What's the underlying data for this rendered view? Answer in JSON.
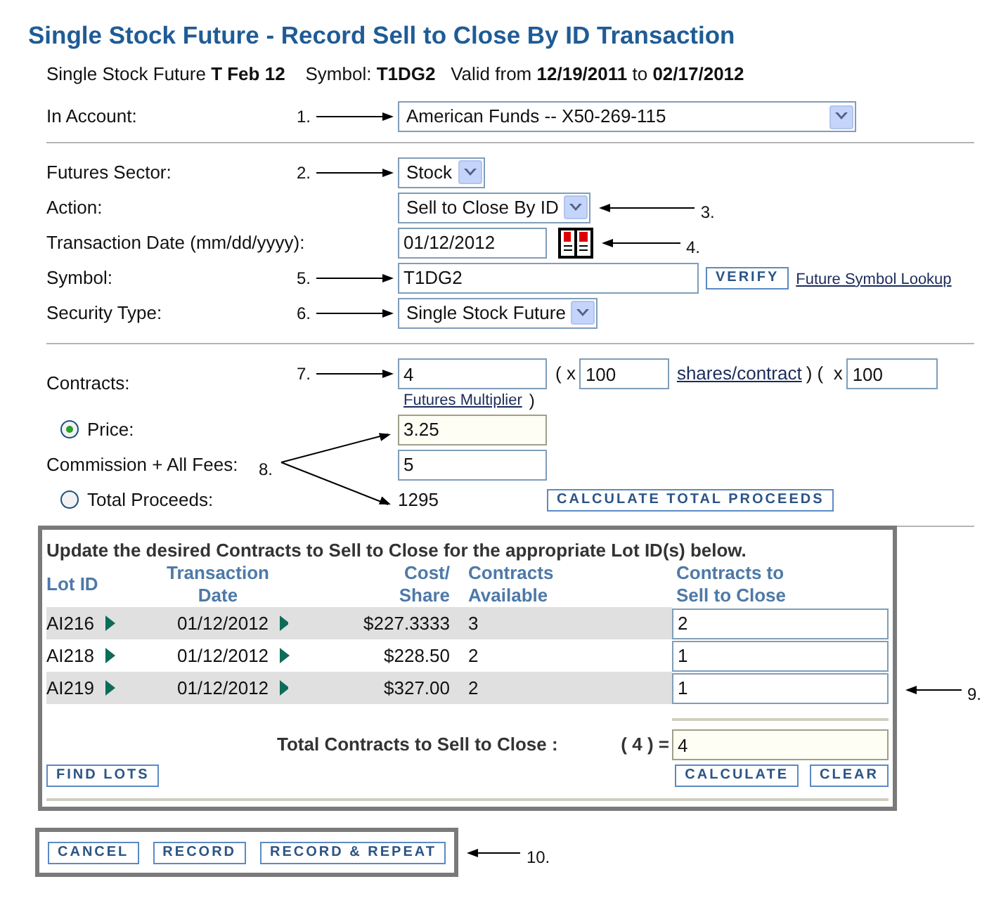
{
  "title": "Single Stock Future - Record Sell to Close By ID Transaction",
  "summary": "Single Stock Future **T Feb 12**    Symbol: **T1DG2**   Valid from **12/19/2011** to **02/17/2012**",
  "account": {
    "label": "In Account:",
    "value": "American Funds -- X50-269-115",
    "callout": "1."
  },
  "fields": [
    {
      "kind": "select",
      "label": "Futures Sector:",
      "value": "Stock",
      "callout": "2.",
      "callout_after": false
    },
    {
      "kind": "select",
      "label": "Action:",
      "value": "Sell to Close By ID",
      "callout": "3.",
      "callout_after": true
    },
    {
      "kind": "date",
      "label": "Transaction Date (mm/dd/yyyy):",
      "value": "01/12/2012",
      "callout": "4.",
      "callout_after": true
    },
    {
      "kind": "symbol",
      "label": "Symbol:",
      "value": "T1DG2",
      "callout": "5.",
      "callout_after": false,
      "button": "VERIFY",
      "link": "Future Symbol Lookup"
    },
    {
      "kind": "select",
      "label": "Security Type:",
      "value": "Single Stock Future",
      "callout": "6.",
      "callout_after": false
    }
  ],
  "contracts": {
    "label": "Contracts:",
    "callout": "7.",
    "value": "4",
    "times_1": "( x",
    "shares": "100",
    "shares_link": "shares/contract",
    "times_2": ") (  x",
    "multiplier": "100",
    "multiplier_link": "Futures Multiplier",
    "close": ")"
  },
  "pricing": {
    "callout": "8.",
    "button": "CALCULATE TOTAL PROCEEDS",
    "rows": [
      {
        "kind": "radio",
        "label": "Price:",
        "selected": true,
        "value": "3.25"
      },
      {
        "kind": "input",
        "label": "Commission + All Fees:",
        "value": "5"
      },
      {
        "kind": "radio",
        "label": "Total Proceeds:",
        "selected": false,
        "value": "1295"
      }
    ]
  },
  "lots": {
    "instruction": "Update the desired Contracts to Sell to Close for the appropriate Lot ID(s) below.",
    "callout": "9.",
    "columns": [
      "Lot ID",
      "Transaction Date",
      "Cost/ Share",
      "Contracts Available",
      "Contracts to Sell to Close"
    ],
    "rows": [
      {
        "lot": "AI216",
        "date": "01/12/2012",
        "cost": "$227.3333",
        "available": "3",
        "sell": "2"
      },
      {
        "lot": "AI218",
        "date": "01/12/2012",
        "cost": "$228.50",
        "available": "2",
        "sell": "1"
      },
      {
        "lot": "AI219",
        "date": "01/12/2012",
        "cost": "$327.00",
        "available": "2",
        "sell": "1"
      }
    ],
    "total_label": "Total Contracts to Sell to Close :",
    "total_sum": "( 4 ) =",
    "total_value": "4",
    "left_buttons": [
      "FIND LOTS"
    ],
    "right_buttons": [
      "CALCULATE",
      "CLEAR"
    ]
  },
  "footer": {
    "buttons": [
      "CANCEL",
      "RECORD",
      "RECORD & REPEAT"
    ],
    "callout": "10."
  }
}
